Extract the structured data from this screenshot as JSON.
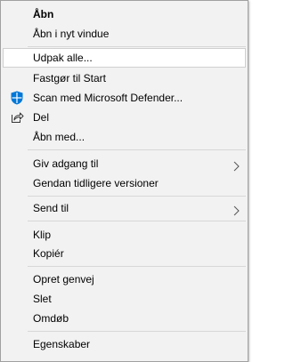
{
  "menu": {
    "items": [
      {
        "label": "Åbn",
        "bold": true
      },
      {
        "label": "Åbn i nyt vindue"
      },
      {
        "label": "Udpak alle..."
      },
      {
        "label": "Fastgør til Start"
      },
      {
        "label": "Scan med Microsoft Defender...",
        "icon": "defender-shield-icon"
      },
      {
        "label": "Del",
        "icon": "share-icon"
      },
      {
        "label": "Åbn med..."
      },
      {
        "label": "Giv adgang til",
        "submenu": true
      },
      {
        "label": "Gendan tidligere versioner"
      },
      {
        "label": "Send til",
        "submenu": true
      },
      {
        "label": "Klip"
      },
      {
        "label": "Kopiér"
      },
      {
        "label": "Opret genvej"
      },
      {
        "label": "Slet"
      },
      {
        "label": "Omdøb"
      },
      {
        "label": "Egenskaber"
      }
    ],
    "hovered_item": "Udpak alle...",
    "colors": {
      "background": "#f2f2f2",
      "hover_background": "#ffffff",
      "separator": "#d7d7d7",
      "defender_blue": "#0078d7"
    }
  }
}
